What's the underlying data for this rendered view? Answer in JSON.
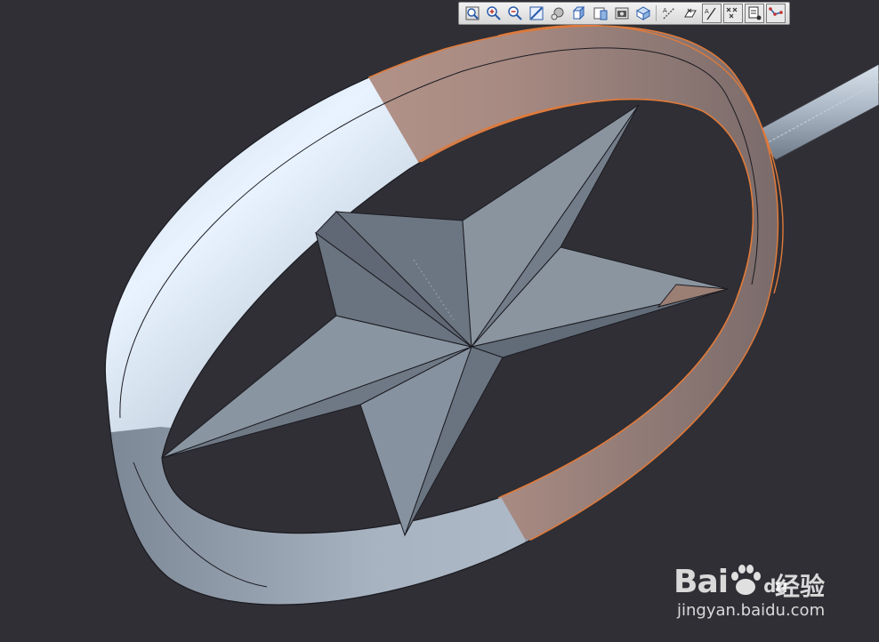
{
  "toolbar": {
    "buttons": [
      {
        "icon": "zoom-fit-icon"
      },
      {
        "icon": "zoom-in-icon"
      },
      {
        "icon": "zoom-out-icon"
      },
      {
        "icon": "repaint-icon"
      },
      {
        "icon": "spin-center-icon"
      },
      {
        "icon": "display-style-icon"
      },
      {
        "icon": "saved-views-icon"
      },
      {
        "icon": "view-manager-icon"
      },
      {
        "icon": "datum-planes-icon"
      },
      {
        "icon": "datum-axes-icon"
      },
      {
        "icon": "datum-points-icon"
      },
      {
        "icon": "coordinate-systems-icon"
      },
      {
        "icon": "annotations-icon"
      },
      {
        "icon": "point-tags-icon"
      },
      {
        "icon": "csys-tags-icon"
      },
      {
        "icon": "sketch-display-icon"
      }
    ]
  },
  "colors": {
    "background": "#2f2f35",
    "part_surface": "#a9b3c0",
    "selection_highlight": "#e07a3a"
  },
  "watermark": {
    "brand": "Bai",
    "brand_suffix": "du",
    "chinese": "经验",
    "url": "jingyan.baidu.com"
  }
}
